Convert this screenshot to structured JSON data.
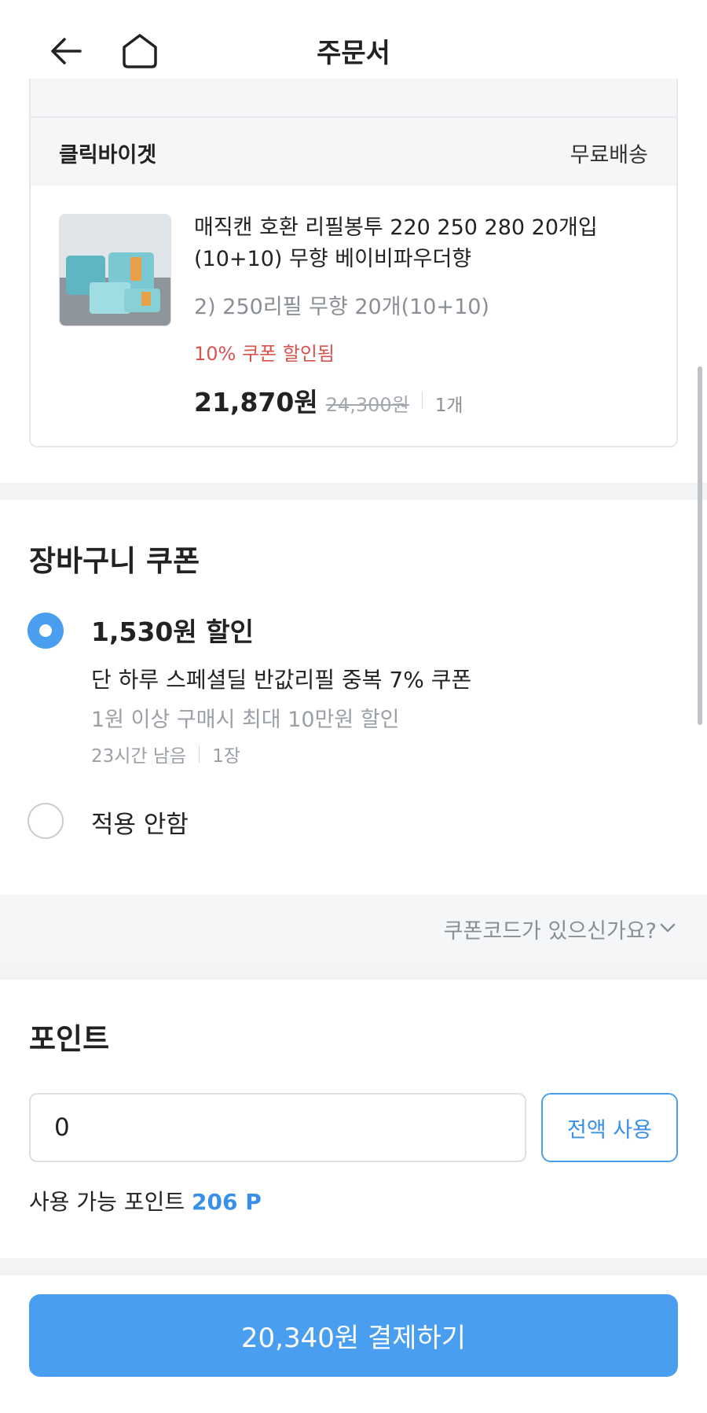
{
  "header": {
    "title": "주문서",
    "back_icon": "arrow-left-icon",
    "home_icon": "home-icon"
  },
  "order_item": {
    "seller": "클릭바이겟",
    "shipping": "무료배송",
    "product_name": "매직캔 호환 리필봉투 220 250 280 20개입 (10+10) 무향 베이비파우더향",
    "option": "2) 250리필 무향 20개(10+10)",
    "coupon_note": "10% 쿠폰 할인됨",
    "price": "21,870원",
    "original_price": "24,300원",
    "quantity": "1개"
  },
  "cart_coupon": {
    "title": "장바구니 쿠폰",
    "options": [
      {
        "amount": "1,530원 할인",
        "name": "단 하루 스페셜딜 반값리필 중복 7% 쿠폰",
        "condition": "1원 이상 구매시 최대 10만원 할인",
        "time_left": "23시간 남음",
        "count": "1장",
        "selected": true
      },
      {
        "label": "적용 안함",
        "selected": false
      }
    ],
    "code_prompt": "쿠폰코드가 있으신가요?"
  },
  "points": {
    "title": "포인트",
    "input_value": "0",
    "use_all_label": "전액 사용",
    "available_label": "사용 가능 포인트",
    "available_value": "206 P"
  },
  "pay_button": {
    "label": "20,340원 결제하기"
  },
  "colors": {
    "accent": "#4a9ef0",
    "discount_red": "#d9534f",
    "muted_text": "#8a8f96",
    "section_gap": "#f2f3f5"
  }
}
